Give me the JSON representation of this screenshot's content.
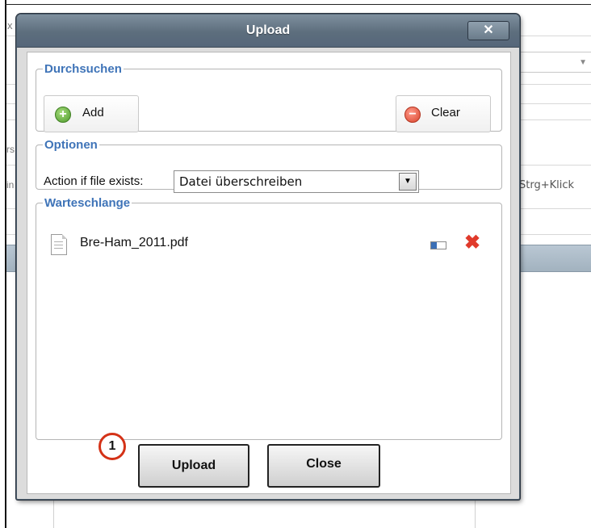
{
  "background": {
    "right_hint": "Strg+Klick",
    "fragment_x": "x",
    "fragment_rs": "rs",
    "fragment_in": "in"
  },
  "dialog": {
    "title": "Upload",
    "close_glyph": "✕",
    "browse": {
      "legend": "Durchsuchen",
      "add_label": "Add",
      "clear_label": "Clear",
      "add_icon": "plus-circle-icon",
      "clear_icon": "minus-circle-icon"
    },
    "options": {
      "legend": "Optionen",
      "action_label": "Action if file exists:",
      "action_value": "Datei überschreiben"
    },
    "queue": {
      "legend": "Warteschlange",
      "files": [
        {
          "name": "Bre-Ham_2011.pdf",
          "progress": 0.4
        }
      ]
    },
    "upload_label": "Upload",
    "close_label": "Close",
    "step_marker": "1"
  },
  "colors": {
    "legend_blue": "#3f74b8",
    "titlebar": "#5d6e7d",
    "remove_red": "#e03a2b",
    "marker_red": "#d43217"
  }
}
